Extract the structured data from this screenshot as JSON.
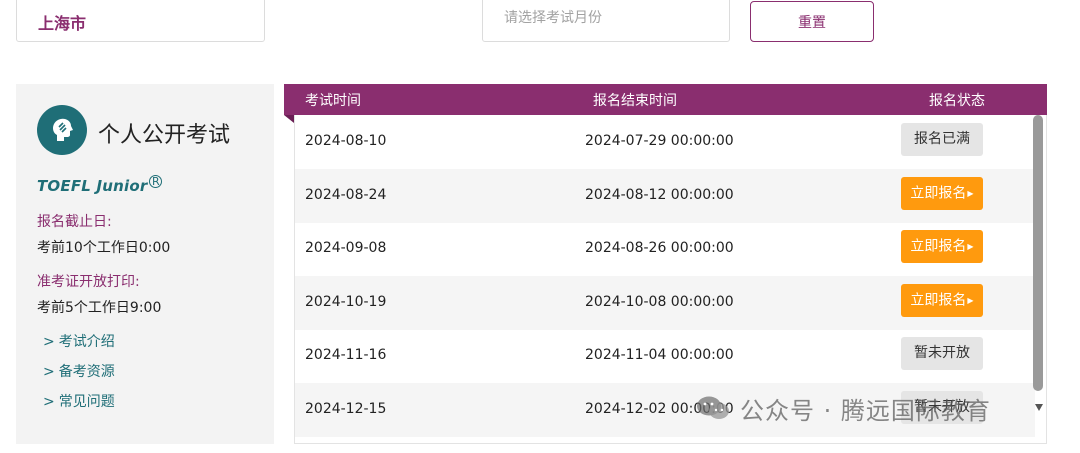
{
  "filters": {
    "city_value": "上海市",
    "month_placeholder": "请选择考试月份",
    "reset_label": "重置"
  },
  "side_panel": {
    "title": "个人公开考试",
    "brand": "TOEFL Junior",
    "brand_mark": "R",
    "deadline_label": "报名截止日:",
    "deadline_value": "考前10个工作日0:00",
    "admission_label": "准考证开放打印:",
    "admission_value": "考前5个工作日9:00",
    "links": [
      "考试介绍",
      "备考资源",
      "常见问题"
    ]
  },
  "table": {
    "headers": [
      "考试时间",
      "报名结束时间",
      "报名状态"
    ],
    "rows": [
      {
        "exam_date": "2024-08-10",
        "reg_end": "2024-07-29 00:00:00",
        "status": "报名已满",
        "status_type": "full"
      },
      {
        "exam_date": "2024-08-24",
        "reg_end": "2024-08-12 00:00:00",
        "status": "立即报名",
        "status_type": "open"
      },
      {
        "exam_date": "2024-09-08",
        "reg_end": "2024-08-26 00:00:00",
        "status": "立即报名",
        "status_type": "open"
      },
      {
        "exam_date": "2024-10-19",
        "reg_end": "2024-10-08 00:00:00",
        "status": "立即报名",
        "status_type": "open"
      },
      {
        "exam_date": "2024-11-16",
        "reg_end": "2024-11-04 00:00:00",
        "status": "暂未开放",
        "status_type": "soon"
      },
      {
        "exam_date": "2024-12-15",
        "reg_end": "2024-12-02 00:00:00",
        "status": "暂未开放",
        "status_type": "soon"
      }
    ]
  },
  "watermark": {
    "text": "公众号 · 腾远国际教育"
  },
  "colors": {
    "brand_purple": "#8a2e6f",
    "teal": "#1f6e77",
    "orange": "#ff9a0e"
  }
}
